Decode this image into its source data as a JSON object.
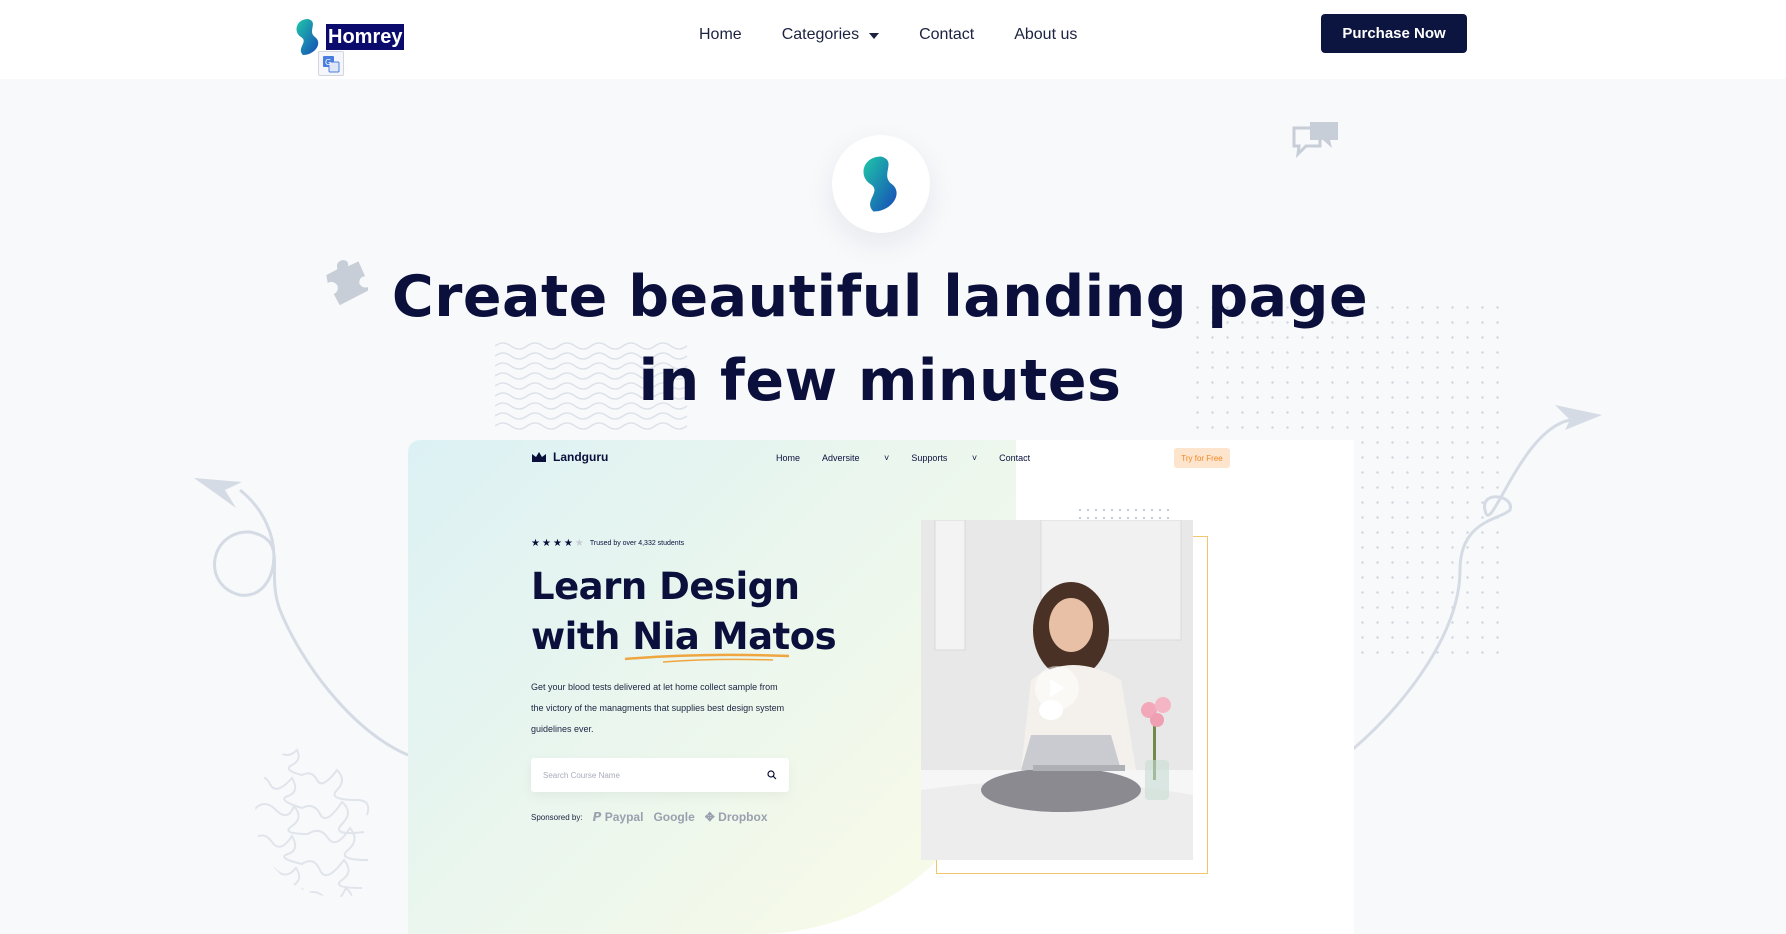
{
  "header": {
    "brand_name": "Homrey",
    "nav": [
      {
        "label": "Home"
      },
      {
        "label": "Categories"
      },
      {
        "label": "Contact"
      },
      {
        "label": "About us"
      }
    ],
    "purchase_label": "Purchase Now"
  },
  "hero": {
    "title_line1": "Create beautiful landing page",
    "title_line2": "in few minutes"
  },
  "preview": {
    "brand": "Landguru",
    "nav": [
      "Home",
      "Adversite",
      "Supports",
      "Contact"
    ],
    "try_label": "Try for Free",
    "rating": {
      "filled": 4,
      "total": 5,
      "text": "Trused by over 4,332 students"
    },
    "title_line1": "Learn Design",
    "title_line2": "with Nia Matos",
    "description": "Get your blood tests delivered at let home collect sample from the victory of the managments that supplies best design system guidelines ever.",
    "search_placeholder": "Search Course Name",
    "sponsor_label": "Sponsored by:",
    "sponsors": [
      "Paypal",
      "Google",
      "Dropbox"
    ]
  },
  "colors": {
    "navy": "#0a0f3c",
    "button": "#0c1440",
    "accent_orange": "#f08a24",
    "brand_highlight": "#0b0b6e"
  }
}
